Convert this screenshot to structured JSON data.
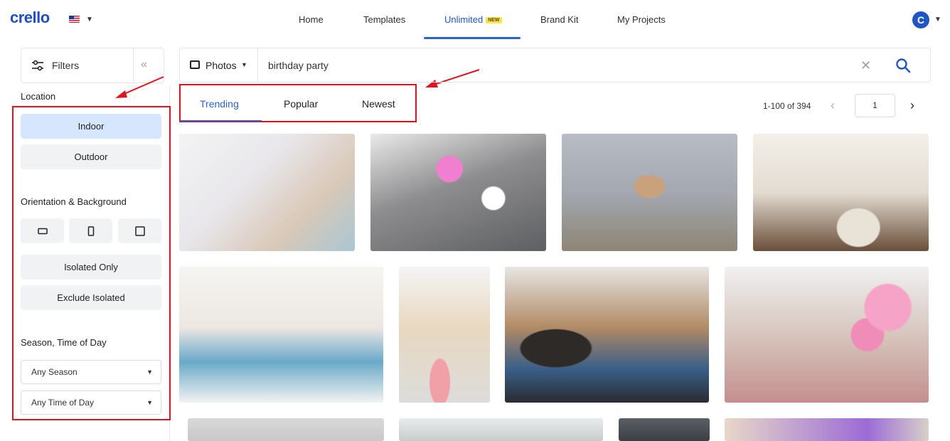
{
  "header": {
    "logo": "crello",
    "nav": [
      {
        "label": "Home"
      },
      {
        "label": "Templates"
      },
      {
        "label": "Unlimited",
        "badge": "NEW",
        "active": true
      },
      {
        "label": "Brand Kit"
      },
      {
        "label": "My Projects"
      }
    ],
    "avatar_initial": "C",
    "flag_icon": "us-flag-icon"
  },
  "sidebar": {
    "filters_label": "Filters",
    "location": {
      "label": "Location",
      "options": [
        "Indoor",
        "Outdoor"
      ],
      "selected": "Indoor"
    },
    "orientation": {
      "label": "Orientation & Background",
      "orientation_icons": [
        "landscape-icon",
        "portrait-icon",
        "square-icon"
      ],
      "options": [
        "Isolated Only",
        "Exclude Isolated"
      ]
    },
    "season": {
      "label": "Season, Time of Day",
      "season_value": "Any Season",
      "time_value": "Any Time of Day"
    }
  },
  "search": {
    "type_label": "Photos",
    "query": "birthday party"
  },
  "tabs": [
    {
      "label": "Trending",
      "active": true
    },
    {
      "label": "Popular"
    },
    {
      "label": "Newest"
    }
  ],
  "pagination": {
    "range_text": "1-100 of 394",
    "page": "1"
  },
  "colors": {
    "accent": "#2c5fd0",
    "annotation_red": "#e0141e",
    "selected_pill": "#d6e6ff"
  }
}
